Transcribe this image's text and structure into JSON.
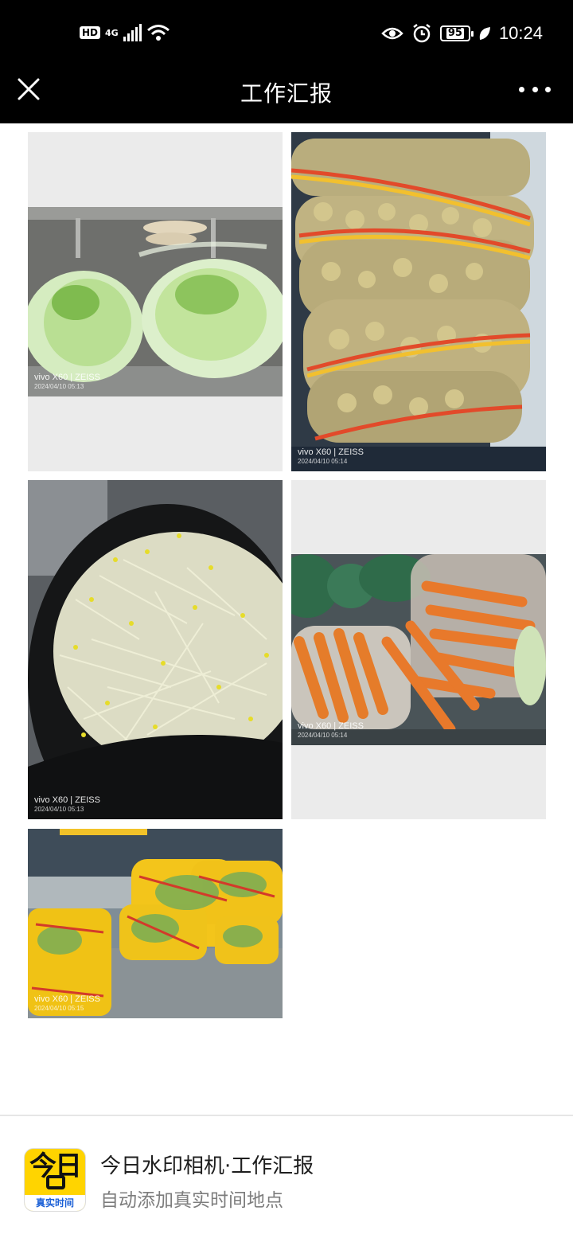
{
  "status_bar": {
    "hd": "HD",
    "network": "4G",
    "battery": "95",
    "time": "10:24",
    "icons": [
      "signal-icon",
      "wifi-icon",
      "eye-icon",
      "alarm-icon",
      "battery-icon",
      "leaf-icon"
    ]
  },
  "header": {
    "title": "工作汇报",
    "close_icon": "close-icon",
    "more_icon": "more-icon"
  },
  "photos": [
    {
      "subject": "cabbage",
      "watermark_brand": "vivo X60 | ZEISS",
      "watermark_date": "2024/04/10 05:13"
    },
    {
      "subject": "potatoes",
      "watermark_brand": "vivo X60 | ZEISS",
      "watermark_date": "2024/04/10 05:14"
    },
    {
      "subject": "bean-sprouts",
      "watermark_brand": "vivo X60 | ZEISS",
      "watermark_date": "2024/04/10 05:13"
    },
    {
      "subject": "carrots",
      "watermark_brand": "vivo X60 | ZEISS",
      "watermark_date": "2024/04/10 05:14"
    },
    {
      "subject": "bok-choy",
      "watermark_brand": "vivo X60 | ZEISS",
      "watermark_date": "2024/04/10 05:15"
    }
  ],
  "ad": {
    "app_icon_text": "今日",
    "app_icon_caption": "真实时间",
    "title": "今日水印相机·工作汇报",
    "subtitle": "自动添加真实时间地点"
  },
  "colors": {
    "header_bg": "#000000",
    "placeholder_bg": "#ebebeb",
    "app_icon_bg": "#ffd400",
    "app_icon_caption": "#1a5fd6"
  }
}
